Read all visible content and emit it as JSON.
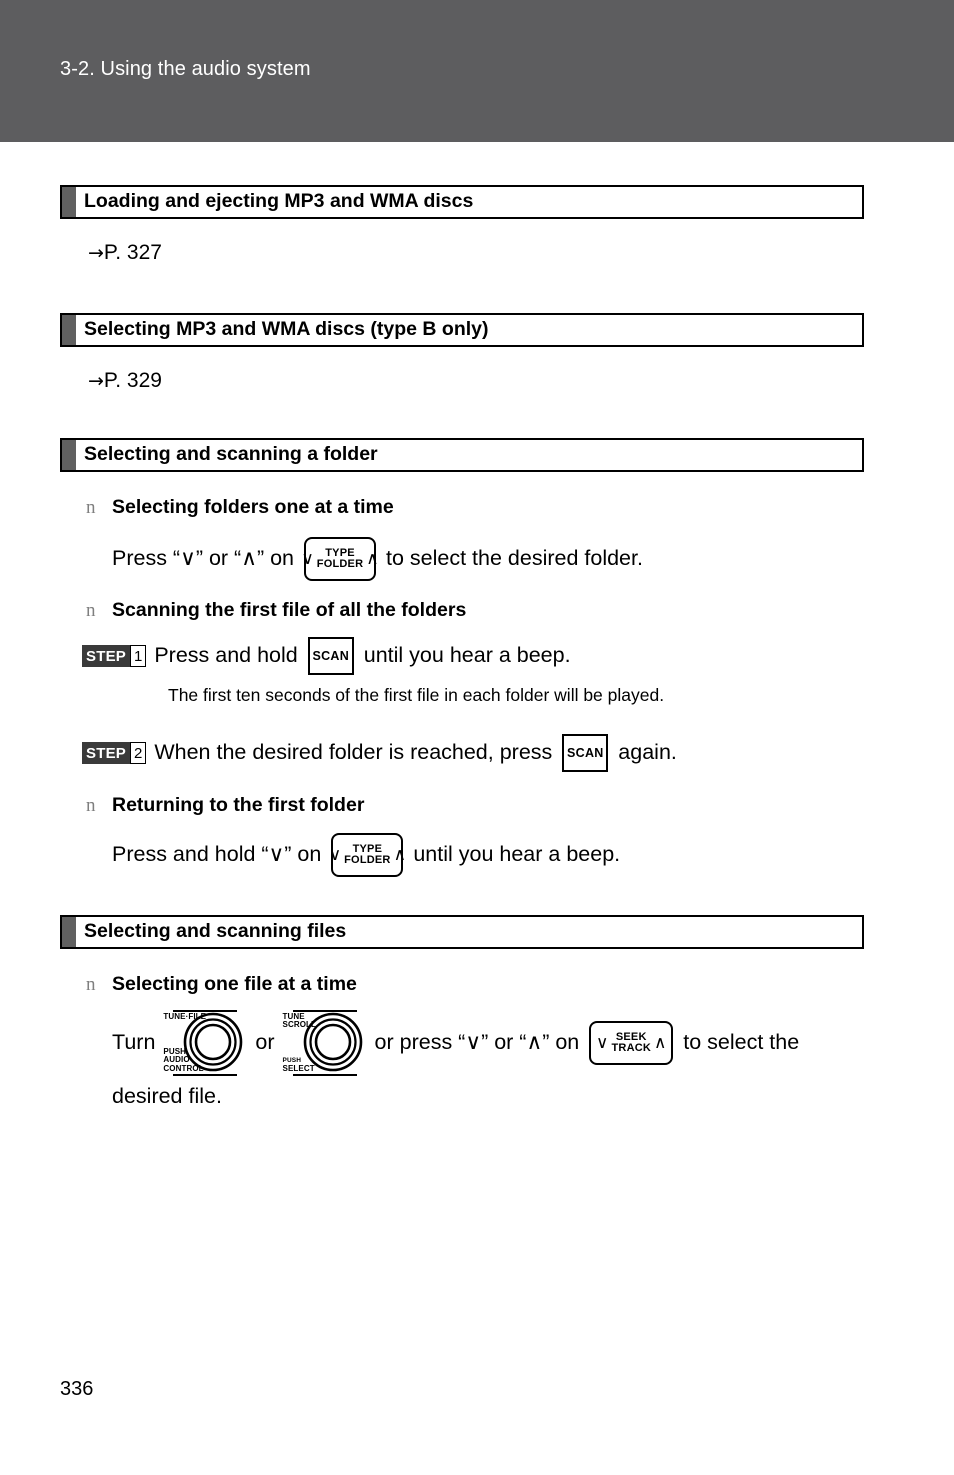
{
  "header": {
    "breadcrumb": "3-2. Using the audio system",
    "band_color": "#5d5d5f"
  },
  "sections": [
    {
      "title": "Loading and ejecting MP3 and WMA discs",
      "xref_arrow": "→",
      "xref": "P. 327"
    },
    {
      "title": "Selecting MP3 and WMA discs (type B only)",
      "xref_arrow": "→",
      "xref": "P. 329"
    },
    {
      "title": "Selecting and scanning a folder"
    },
    {
      "title": "Selecting and scanning files"
    }
  ],
  "bullet_marker": "n",
  "folder_section": {
    "sub1": {
      "heading": "Selecting folders one at a time",
      "text_before": "Press “∨” or “∧” on",
      "text_after": "to select the desired folder."
    },
    "sub2": {
      "heading": "Scanning the first file of all the folders",
      "step1": {
        "step_word": "STEP",
        "step_num": "1",
        "text_before": "Press and hold",
        "text_after": "until you hear a beep.",
        "note": "The first ten seconds of the first file in each folder will be played."
      },
      "step2": {
        "step_word": "STEP",
        "step_num": "2",
        "text_before": "When the desired folder is reached, press",
        "text_after": "again."
      }
    },
    "sub3": {
      "heading": "Returning to the first folder",
      "text_before": "Press and hold “∨” on",
      "text_after": "until you hear a beep."
    }
  },
  "files_section": {
    "sub1": {
      "heading": "Selecting one file at a time",
      "t1": "Turn",
      "t2": "or",
      "t3": "or press “∨” or “∧” on",
      "t4": "to select the",
      "t5": "desired file."
    }
  },
  "keys": {
    "scan": "SCAN",
    "type_folder": {
      "down_chevron": "∨",
      "up_chevron": "∧",
      "line1": "TYPE",
      "line2": "FOLDER"
    },
    "seek_track": {
      "down_chevron": "∨",
      "up_chevron": "∧",
      "line1": "SEEK",
      "line2": "TRACK"
    }
  },
  "dials": {
    "audio_control": {
      "top_label": "TUNE·FILE",
      "bottom_line1": "PUSH",
      "bottom_line2": "AUDIO",
      "bottom_line3": "CONTROL"
    },
    "select": {
      "top_line1": "TUNE",
      "top_line2": "SCROLL",
      "bottom_line1": "PUSH",
      "bottom_line2": "SELECT"
    }
  },
  "page_number": "336"
}
